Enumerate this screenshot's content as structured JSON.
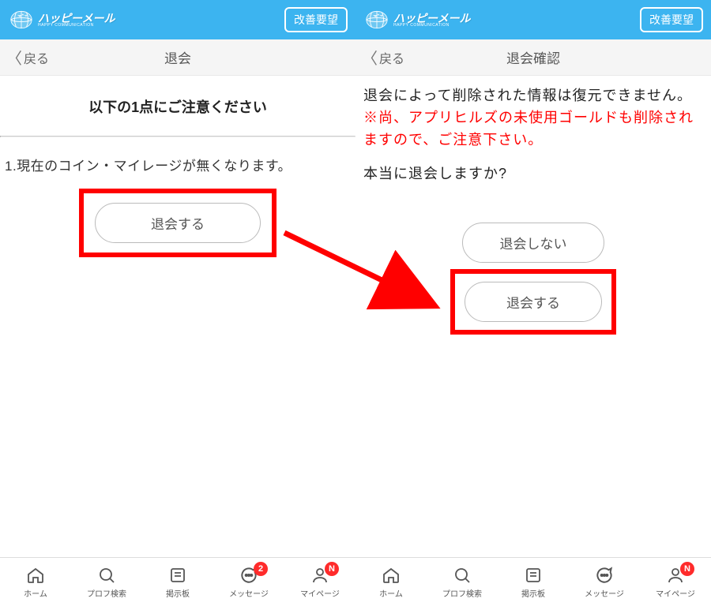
{
  "common": {
    "brand": "ハッピーメール",
    "brand_sub": "HAPPY COMMUNICATION",
    "improve_label": "改善要望",
    "back_label": "戻る"
  },
  "bottomnav": {
    "home": "ホーム",
    "search": "プロフ検索",
    "board": "掲示板",
    "message": "メッセージ",
    "mypage": "マイページ",
    "msg_badge": "2",
    "my_badge": "N"
  },
  "left": {
    "title": "退会",
    "notice_heading": "以下の1点にご注意ください",
    "notice_item": "1.現在のコイン・マイレージが無くなります。",
    "withdraw_btn": "退会する"
  },
  "right": {
    "title": "退会確認",
    "line1": "退会によって削除された情報は復元できません。",
    "warn": "※尚、アプリヒルズの未使用ゴールドも削除されますので、ご注意下さい。",
    "question": "本当に退会しますか?",
    "cancel_btn": "退会しない",
    "withdraw_btn": "退会する"
  }
}
